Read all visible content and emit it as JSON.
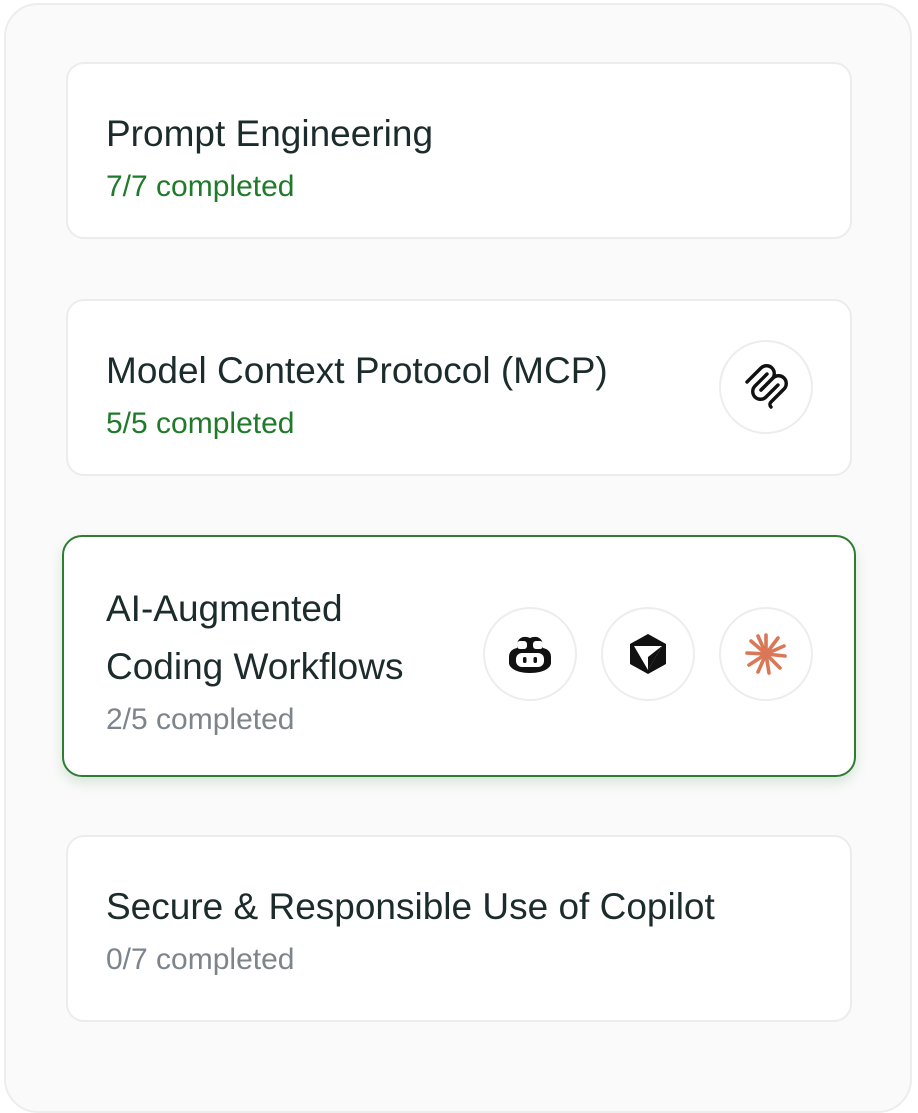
{
  "courses": [
    {
      "title": "Prompt Engineering",
      "progress": "7/7 completed",
      "state": "done"
    },
    {
      "title": "Model Context Protocol (MCP)",
      "progress": "5/5 completed",
      "state": "done",
      "icons": [
        "mcp-icon"
      ]
    },
    {
      "title_lines": [
        "AI-Augmented",
        "Coding Workflows"
      ],
      "progress": "2/5 completed",
      "state": "in-progress",
      "selected": true,
      "icons": [
        "copilot-icon",
        "cursor-icon",
        "claude-icon"
      ]
    },
    {
      "title": "Secure & Responsible Use of Copilot",
      "progress": "0/7 completed",
      "state": "not-started"
    }
  ],
  "colors": {
    "accent_green": "#1f7a2a",
    "selected_border": "#2e7d32",
    "muted_text": "#7d848c",
    "claude_orange": "#d97757"
  }
}
